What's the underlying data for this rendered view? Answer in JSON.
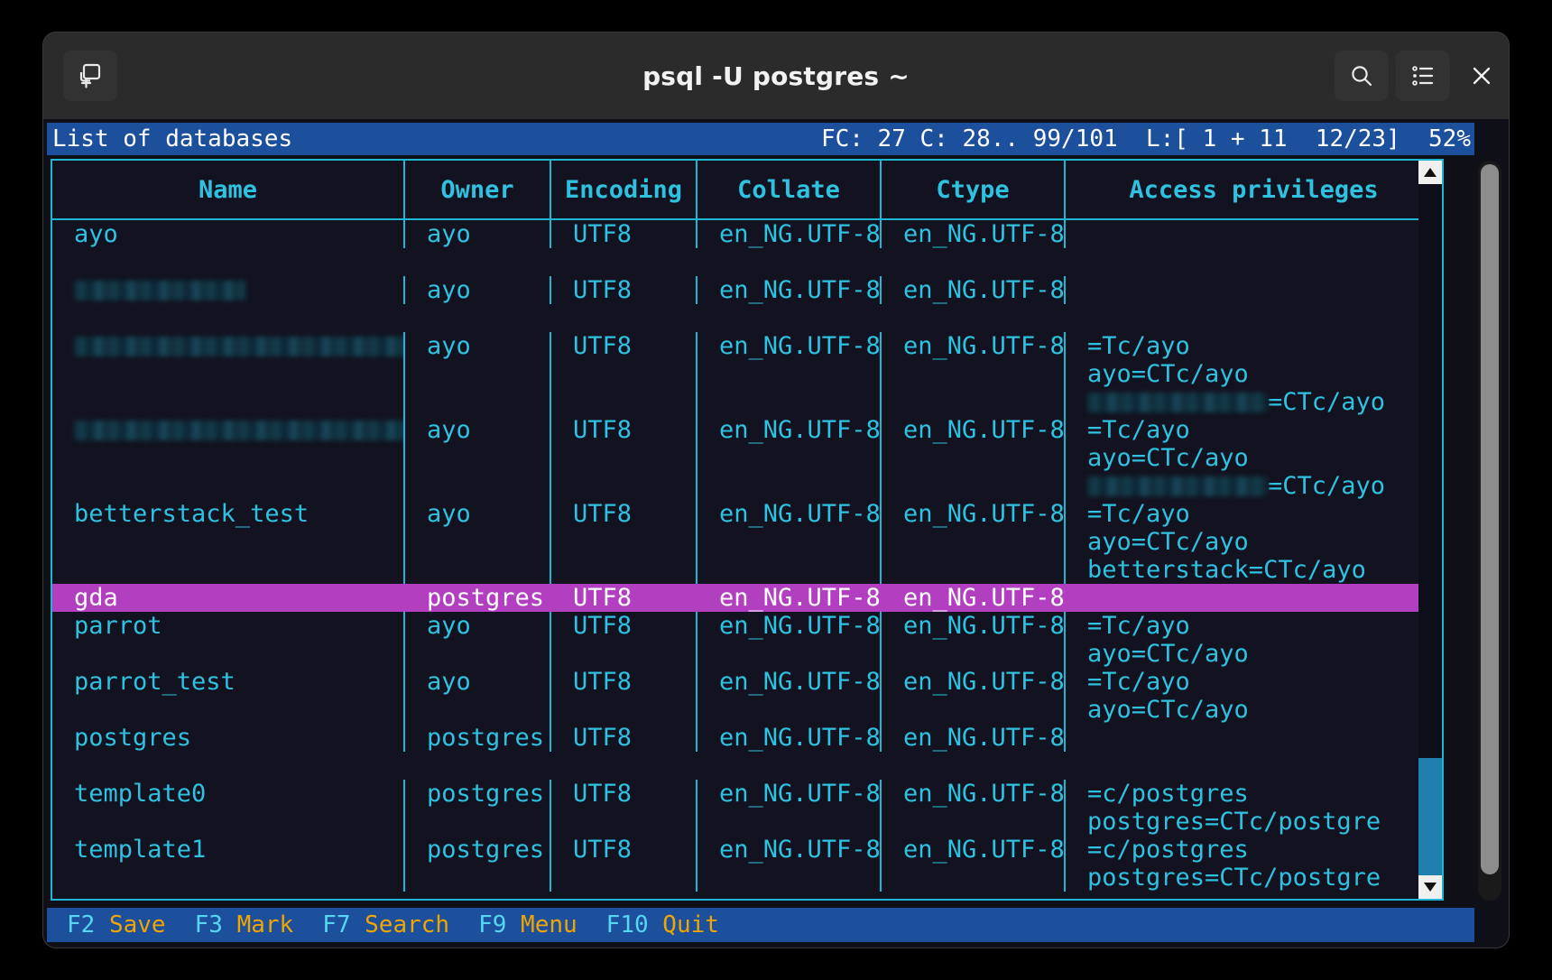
{
  "window": {
    "title": "psql -U postgres ~",
    "buttons": {
      "new_tab": "new-tab",
      "search": "search",
      "list": "list",
      "close": "close"
    }
  },
  "status_bar": {
    "left": "List of databases",
    "right": "FC: 27 C: 28.. 99/101  L:[ 1 + 11  12/23]  52%"
  },
  "table": {
    "headers": [
      "Name",
      "Owner",
      "Encoding",
      "Collate",
      "Ctype",
      "Access privileges"
    ],
    "rows": [
      {
        "name": "ayo",
        "owner": "ayo",
        "encoding": "UTF8",
        "collate": "en_NG.UTF-8",
        "ctype": "en_NG.UTF-8",
        "privileges": ""
      },
      {
        "name": "[redacted]",
        "name_redacted": true,
        "owner": "ayo",
        "encoding": "UTF8",
        "collate": "en_NG.UTF-8",
        "ctype": "en_NG.UTF-8",
        "privileges": ""
      },
      {
        "name": "[redacted]",
        "name_redacted": true,
        "owner": "ayo",
        "encoding": "UTF8",
        "collate": "en_NG.UTF-8",
        "ctype": "en_NG.UTF-8",
        "privileges": [
          "=Tc/ayo",
          "ayo=CTc/ayo",
          "[redacted]=CTc/ayo"
        ]
      },
      {
        "name": "[redacted]",
        "name_redacted": true,
        "owner": "ayo",
        "encoding": "UTF8",
        "collate": "en_NG.UTF-8",
        "ctype": "en_NG.UTF-8",
        "privileges": [
          "=Tc/ayo",
          "ayo=CTc/ayo",
          "[redacted]=CTc/ayo"
        ]
      },
      {
        "name": "betterstack_test",
        "owner": "ayo",
        "encoding": "UTF8",
        "collate": "en_NG.UTF-8",
        "ctype": "en_NG.UTF-8",
        "privileges": [
          "=Tc/ayo",
          "ayo=CTc/ayo",
          "betterstack=CTc/ayo"
        ]
      },
      {
        "name": "gda",
        "owner": "postgres",
        "encoding": "UTF8",
        "collate": "en_NG.UTF-8",
        "ctype": "en_NG.UTF-8",
        "privileges": "",
        "selected": true
      },
      {
        "name": "parrot",
        "owner": "ayo",
        "encoding": "UTF8",
        "collate": "en_NG.UTF-8",
        "ctype": "en_NG.UTF-8",
        "privileges": [
          "=Tc/ayo",
          "ayo=CTc/ayo"
        ]
      },
      {
        "name": "parrot_test",
        "owner": "ayo",
        "encoding": "UTF8",
        "collate": "en_NG.UTF-8",
        "ctype": "en_NG.UTF-8",
        "privileges": [
          "=Tc/ayo",
          "ayo=CTc/ayo"
        ]
      },
      {
        "name": "postgres",
        "owner": "postgres",
        "encoding": "UTF8",
        "collate": "en_NG.UTF-8",
        "ctype": "en_NG.UTF-8",
        "privileges": ""
      },
      {
        "name": "template0",
        "owner": "postgres",
        "encoding": "UTF8",
        "collate": "en_NG.UTF-8",
        "ctype": "en_NG.UTF-8",
        "privileges": [
          "=c/postgres",
          "postgres=CTc/postgre"
        ]
      },
      {
        "name": "template1",
        "owner": "postgres",
        "encoding": "UTF8",
        "collate": "en_NG.UTF-8",
        "ctype": "en_NG.UTF-8",
        "privileges": [
          "=c/postgres",
          "postgres=CTc/postgre"
        ]
      }
    ]
  },
  "function_keys": [
    {
      "key": "F2",
      "label": "Save"
    },
    {
      "key": "F3",
      "label": "Mark"
    },
    {
      "key": "F7",
      "label": "Search"
    },
    {
      "key": "F9",
      "label": "Menu"
    },
    {
      "key": "F10",
      "label": "Quit"
    }
  ],
  "colors": {
    "terminal_bg": "#0f0f17",
    "accent_cyan": "#2fc2e0",
    "status_blue": "#1c4f9c",
    "selection_magenta": "#b13fc0",
    "fkey_label": "#f0a500"
  }
}
